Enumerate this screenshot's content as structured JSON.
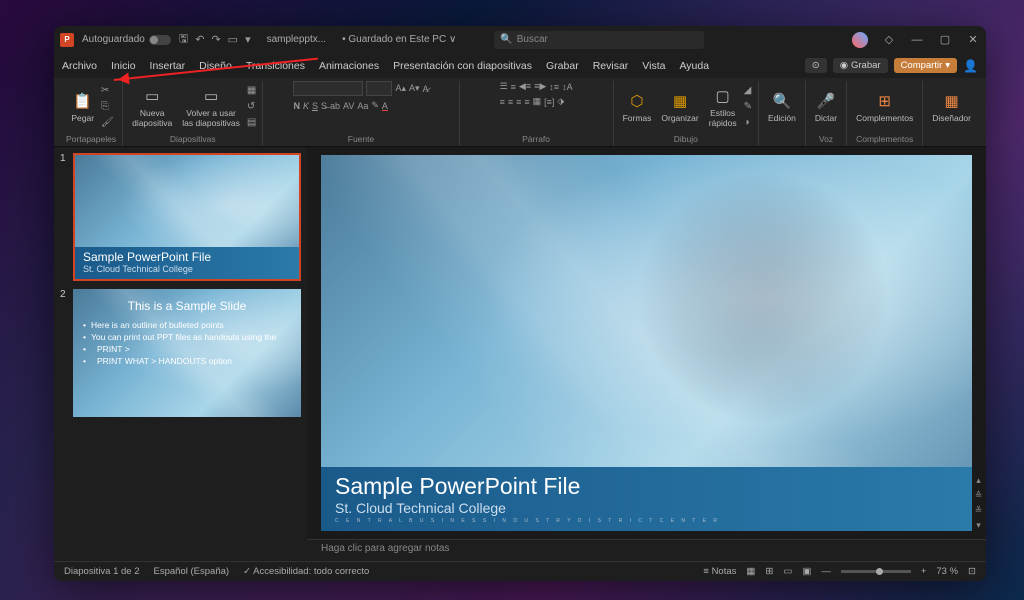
{
  "titlebar": {
    "autosave": "Autoguardado",
    "filename": "samplepptx...",
    "saved": "• Guardado en Este PC ∨",
    "search_placeholder": "Buscar"
  },
  "tabs": {
    "items": [
      "Archivo",
      "Inicio",
      "Insertar",
      "Diseño",
      "Transiciones",
      "Animaciones",
      "Presentación con diapositivas",
      "Grabar",
      "Revisar",
      "Vista",
      "Ayuda"
    ],
    "record": "Grabar",
    "share": "Compartir"
  },
  "ribbon": {
    "paste": "Pegar",
    "clipboard": "Portapapeles",
    "new_slide": "Nueva\ndiapositiva",
    "reuse": "Volver a usar\nlas diapositivas",
    "slides": "Diapositivas",
    "font": "Fuente",
    "paragraph": "Párrafo",
    "shapes": "Formas",
    "arrange": "Organizar",
    "styles": "Estilos\nrápidos",
    "drawing": "Dibujo",
    "editing": "Edición",
    "dictate": "Dictar",
    "voice": "Voz",
    "addins": "Complementos",
    "addins_grp": "Complementos",
    "designer": "Diseñador"
  },
  "slides": {
    "s1": {
      "num": "1",
      "title": "Sample PowerPoint File",
      "subtitle": "St. Cloud Technical College"
    },
    "s2": {
      "num": "2",
      "title": "This is a Sample Slide",
      "bullets": [
        "Here is an outline of bulleted points",
        "You can print out PPT files as handouts using the",
        "PRINT >",
        "PRINT WHAT > HANDOUTS option"
      ]
    }
  },
  "main_slide": {
    "title": "Sample PowerPoint File",
    "subtitle": "St. Cloud Technical College",
    "tiny": "C E N T R A L   B U S I N E S S   I N D U S T R Y   D I S T R I C T   C E N T E R"
  },
  "notes": "Haga clic para agregar notas",
  "status": {
    "slide": "Diapositiva 1 de 2",
    "lang": "Español (España)",
    "access": "Accesibilidad: todo correcto",
    "notes": "Notas",
    "zoom": "73 %"
  }
}
